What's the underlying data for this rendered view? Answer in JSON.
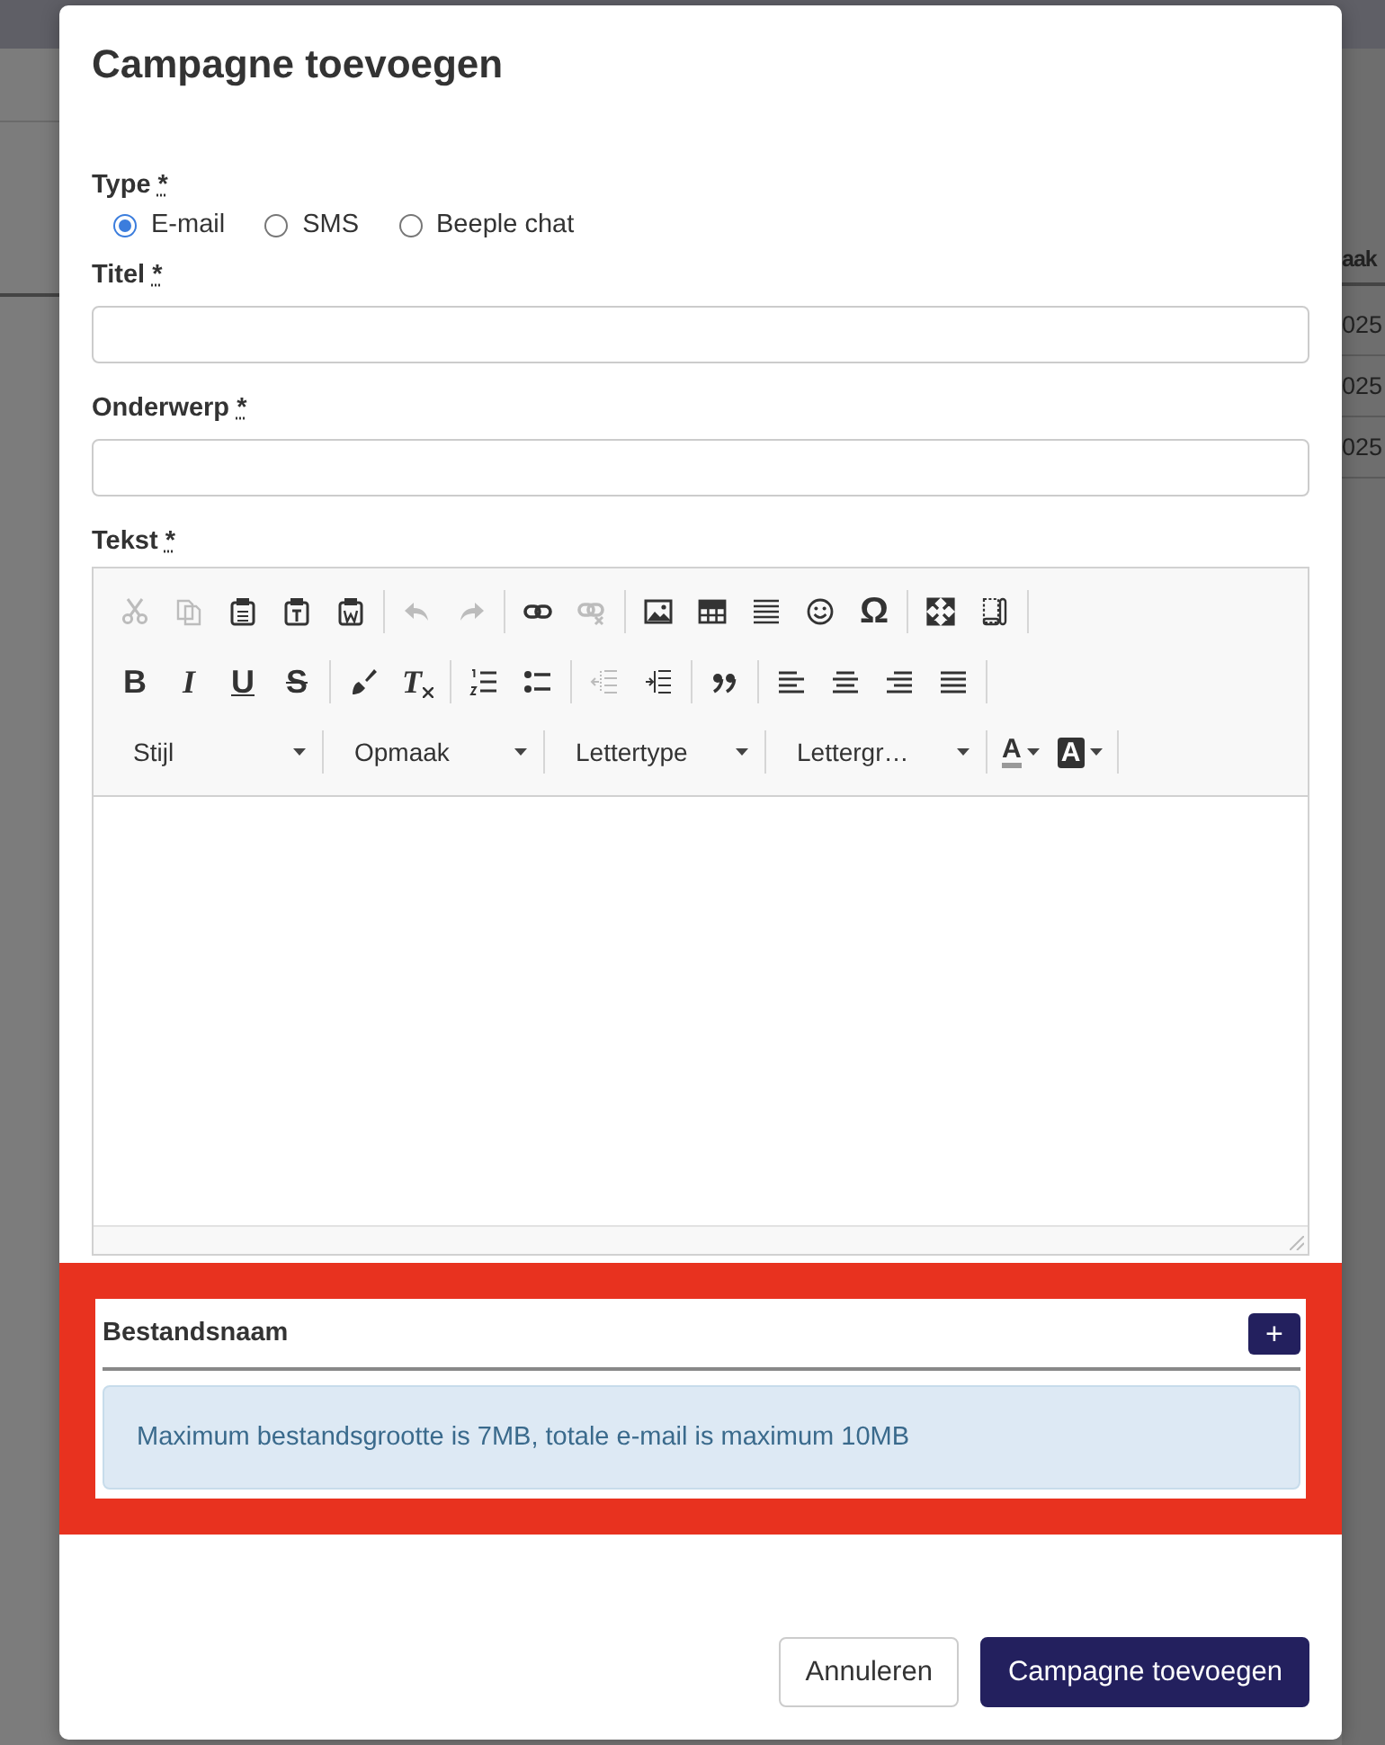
{
  "background": {
    "column_header": "aak",
    "cells": [
      "025",
      "025",
      "025"
    ]
  },
  "modal": {
    "title": "Campagne toevoegen",
    "type": {
      "label": "Type",
      "required_mark": "*",
      "options": [
        {
          "label": "E-mail",
          "selected": true
        },
        {
          "label": "SMS",
          "selected": false
        },
        {
          "label": "Beeple chat",
          "selected": false
        }
      ]
    },
    "fields": [
      {
        "label": "Titel",
        "required_mark": "*"
      },
      {
        "label": "Onderwerp",
        "required_mark": "*"
      }
    ],
    "editor": {
      "label": "Tekst",
      "required_mark": "*",
      "toolbar": [
        [
          [
            {
              "kind": "cut",
              "disabled": true
            },
            {
              "kind": "copy",
              "disabled": true
            },
            {
              "kind": "paste",
              "disabled": false
            },
            {
              "kind": "paste-text",
              "disabled": false
            },
            {
              "kind": "paste-word",
              "disabled": false
            }
          ],
          [
            {
              "kind": "undo",
              "disabled": true
            },
            {
              "kind": "redo",
              "disabled": true
            }
          ],
          [
            {
              "kind": "link",
              "disabled": false
            },
            {
              "kind": "unlink",
              "disabled": true
            }
          ],
          [
            {
              "kind": "image",
              "disabled": false
            },
            {
              "kind": "table",
              "disabled": false
            },
            {
              "kind": "hline",
              "disabled": false
            },
            {
              "kind": "smiley",
              "disabled": false
            },
            {
              "kind": "char",
              "label": "Ω",
              "disabled": false
            }
          ],
          [
            {
              "kind": "maximize",
              "disabled": false
            },
            {
              "kind": "blocks",
              "disabled": false
            }
          ]
        ],
        [
          [
            {
              "kind": "bold",
              "label": "B",
              "disabled": false
            },
            {
              "kind": "italic",
              "label": "I",
              "disabled": false
            },
            {
              "kind": "underline",
              "label": "U",
              "disabled": false
            },
            {
              "kind": "strike",
              "label": "S",
              "disabled": false
            }
          ],
          [
            {
              "kind": "brush",
              "disabled": false
            },
            {
              "kind": "clear",
              "label": "T",
              "disabled": false
            }
          ],
          [
            {
              "kind": "ol",
              "disabled": false
            },
            {
              "kind": "ul",
              "disabled": false
            }
          ],
          [
            {
              "kind": "outdent",
              "disabled": true
            },
            {
              "kind": "indent",
              "disabled": false
            }
          ],
          [
            {
              "kind": "quote",
              "disabled": false
            }
          ],
          [
            {
              "kind": "align-left",
              "disabled": false
            },
            {
              "kind": "align-center",
              "disabled": false
            },
            {
              "kind": "align-right",
              "disabled": false
            },
            {
              "kind": "justify",
              "disabled": false
            }
          ]
        ],
        [
          [
            {
              "kind": "combo",
              "label": "Stijl"
            }
          ],
          [
            {
              "kind": "combo",
              "label": "Opmaak"
            }
          ],
          [
            {
              "kind": "combo",
              "label": "Lettertype"
            }
          ],
          [
            {
              "kind": "combo",
              "label": "Lettergr…"
            }
          ],
          [
            {
              "kind": "text-color",
              "label": "A"
            },
            {
              "kind": "bg-color",
              "label": "A"
            }
          ]
        ]
      ]
    },
    "attachments": {
      "column_header": "Bestandsnaam",
      "add_label": "+",
      "info": "Maximum bestandsgrootte is 7MB, totale e-mail is maximum 10MB"
    },
    "buttons": [
      {
        "label": "Annuleren",
        "kind": "secondary"
      },
      {
        "label": "Campagne toevoegen",
        "kind": "primary"
      }
    ]
  }
}
